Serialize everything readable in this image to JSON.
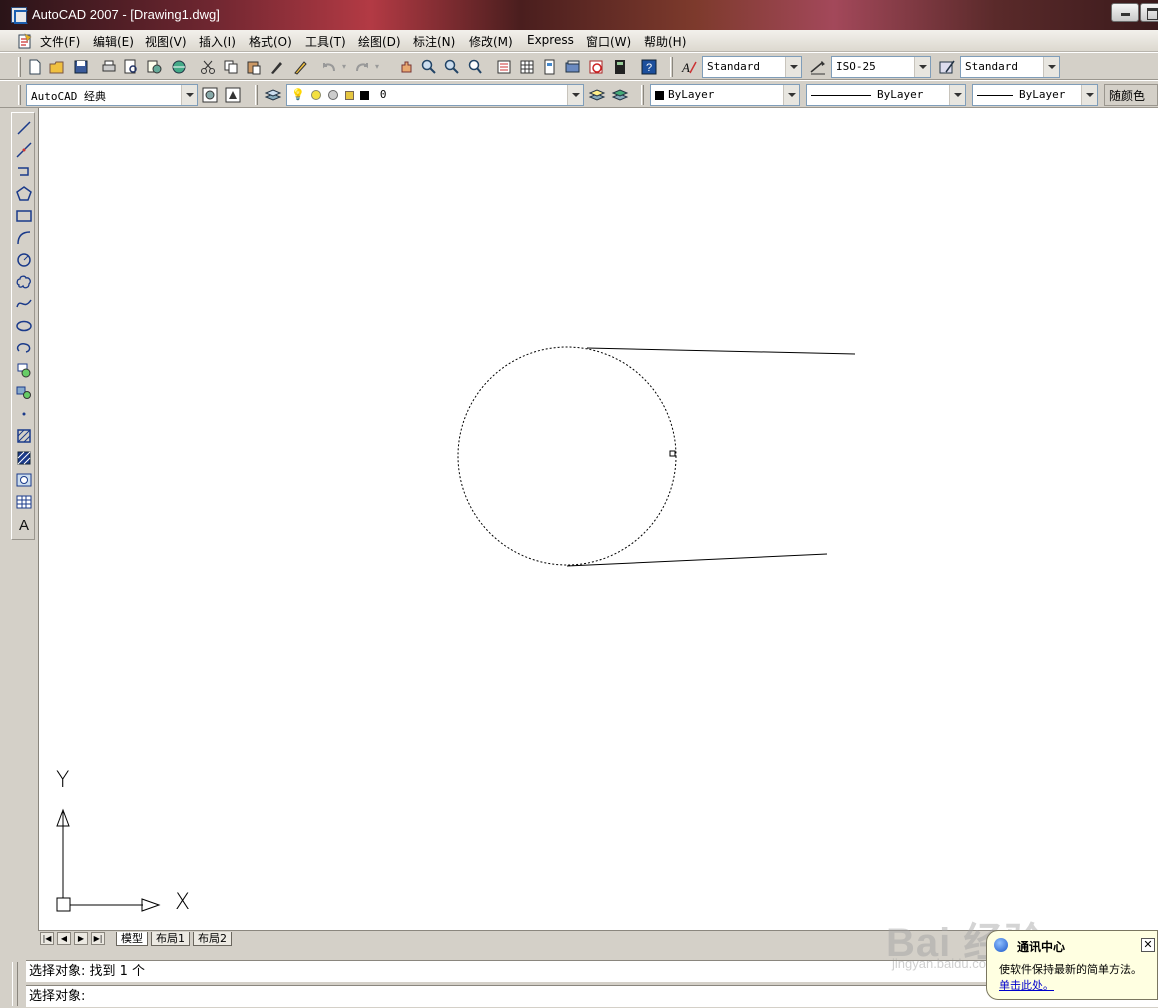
{
  "window": {
    "title": "AutoCAD 2007 - [Drawing1.dwg]"
  },
  "menu": {
    "items": [
      "文件(F)",
      "编辑(E)",
      "视图(V)",
      "插入(I)",
      "格式(O)",
      "工具(T)",
      "绘图(D)",
      "标注(N)",
      "修改(M)",
      "Express",
      "窗口(W)",
      "帮助(H)"
    ]
  },
  "toolbar1": {
    "text_style": "Standard",
    "dim_style": "ISO-25",
    "table_style": "Standard"
  },
  "toolbar2": {
    "workspace": "AutoCAD 经典",
    "layer": "0",
    "color": "ByLayer",
    "linetype": "ByLayer",
    "lineweight": "ByLayer",
    "plot_style": "随颜色"
  },
  "ucs": {
    "x_label": "X",
    "y_label": "Y"
  },
  "tabs": {
    "model": "模型",
    "layout1": "布局1",
    "layout2": "布局2"
  },
  "command": {
    "line1": "选择对象: 找到 1 个",
    "line2": "选择对象:"
  },
  "comm_center": {
    "title": "通讯中心",
    "message": "使软件保持最新的简单方法。",
    "link": "单击此处。"
  },
  "watermark": {
    "brand": "Bai 经验",
    "url": "jingyan.baidu.com"
  },
  "colors": {
    "canvas_bg": "#ffffff",
    "chrome_bg": "#d4d0c8",
    "balloon_bg": "#ffffe1",
    "link": "#0000cc"
  }
}
